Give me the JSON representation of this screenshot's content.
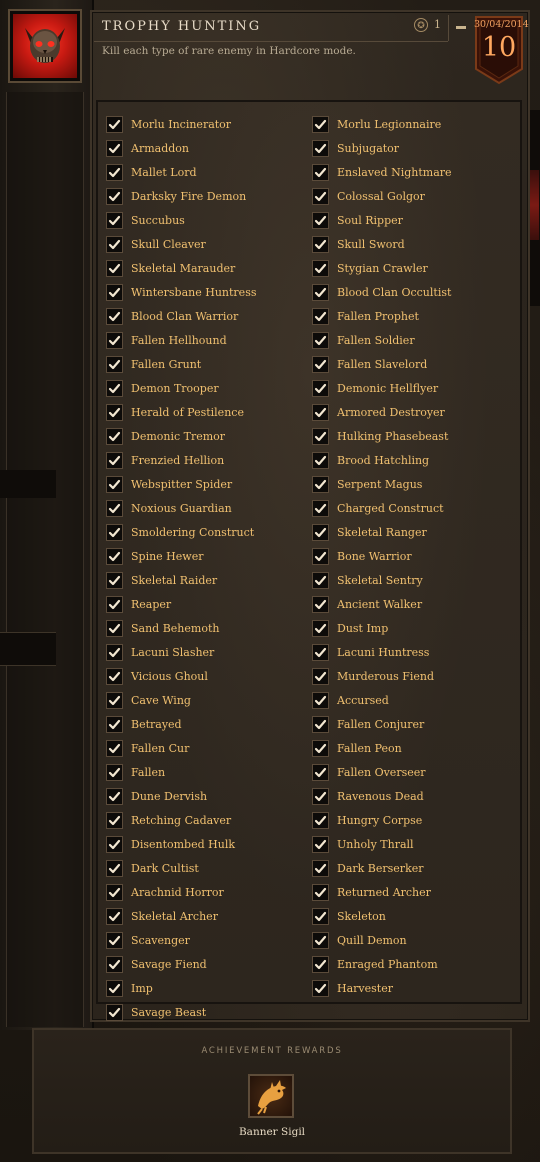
{
  "achievement": {
    "title": "TROPHY HUNTING",
    "description": "Kill each type of rare enemy in Hardcore mode.",
    "points": "1",
    "date": "30/04/2014",
    "day": "10"
  },
  "criteria_left": [
    "Morlu Incinerator",
    "Armaddon",
    "Mallet Lord",
    "Darksky Fire Demon",
    "Succubus",
    "Skull Cleaver",
    "Skeletal Marauder",
    "Wintersbane Huntress",
    "Blood Clan Warrior",
    "Fallen Hellhound",
    "Fallen Grunt",
    "Demon Trooper",
    "Herald of Pestilence",
    "Demonic Tremor",
    "Frenzied Hellion",
    "Webspitter Spider",
    "Noxious Guardian",
    "Smoldering Construct",
    "Spine Hewer",
    "Skeletal Raider",
    "Reaper",
    "Sand Behemoth",
    "Lacuni Slasher",
    "Vicious Ghoul",
    "Cave Wing",
    "Betrayed",
    "Fallen Cur",
    "Fallen",
    "Dune Dervish",
    "Retching Cadaver",
    "Disentombed Hulk",
    "Dark Cultist",
    "Arachnid Horror",
    "Skeletal Archer",
    "Scavenger",
    "Savage Fiend",
    "Imp",
    "Savage Beast"
  ],
  "criteria_right": [
    "Morlu Legionnaire",
    "Subjugator",
    "Enslaved Nightmare",
    "Colossal Golgor",
    "Soul Ripper",
    "Skull Sword",
    "Stygian Crawler",
    "Blood Clan Occultist",
    "Fallen Prophet",
    "Fallen Soldier",
    "Fallen Slavelord",
    "Demonic Hellflyer",
    "Armored Destroyer",
    "Hulking Phasebeast",
    "Brood Hatchling",
    "Serpent Magus",
    "Charged Construct",
    "Skeletal Ranger",
    "Bone Warrior",
    "Skeletal Sentry",
    "Ancient Walker",
    "Dust Imp",
    "Lacuni Huntress",
    "Murderous Fiend",
    "Accursed",
    "Fallen Conjurer",
    "Fallen Peon",
    "Fallen Overseer",
    "Ravenous Dead",
    "Hungry Corpse",
    "Unholy Thrall",
    "Dark Berserker",
    "Returned Archer",
    "Skeleton",
    "Quill Demon",
    "Enraged Phantom",
    "Harvester"
  ],
  "rewards": {
    "title": "ACHIEVEMENT REWARDS",
    "item_label": "Banner Sigil"
  },
  "colors": {
    "accent": "#f0c070",
    "badge_red": "#c81a12",
    "date_orange": "#ffa860"
  },
  "icons": {
    "achievement_badge": "demon-skull-icon",
    "points": "achievement-point-icon",
    "collapse": "collapse-icon",
    "checkbox": "checkmark-icon",
    "reward": "dragon-sigil-icon"
  }
}
